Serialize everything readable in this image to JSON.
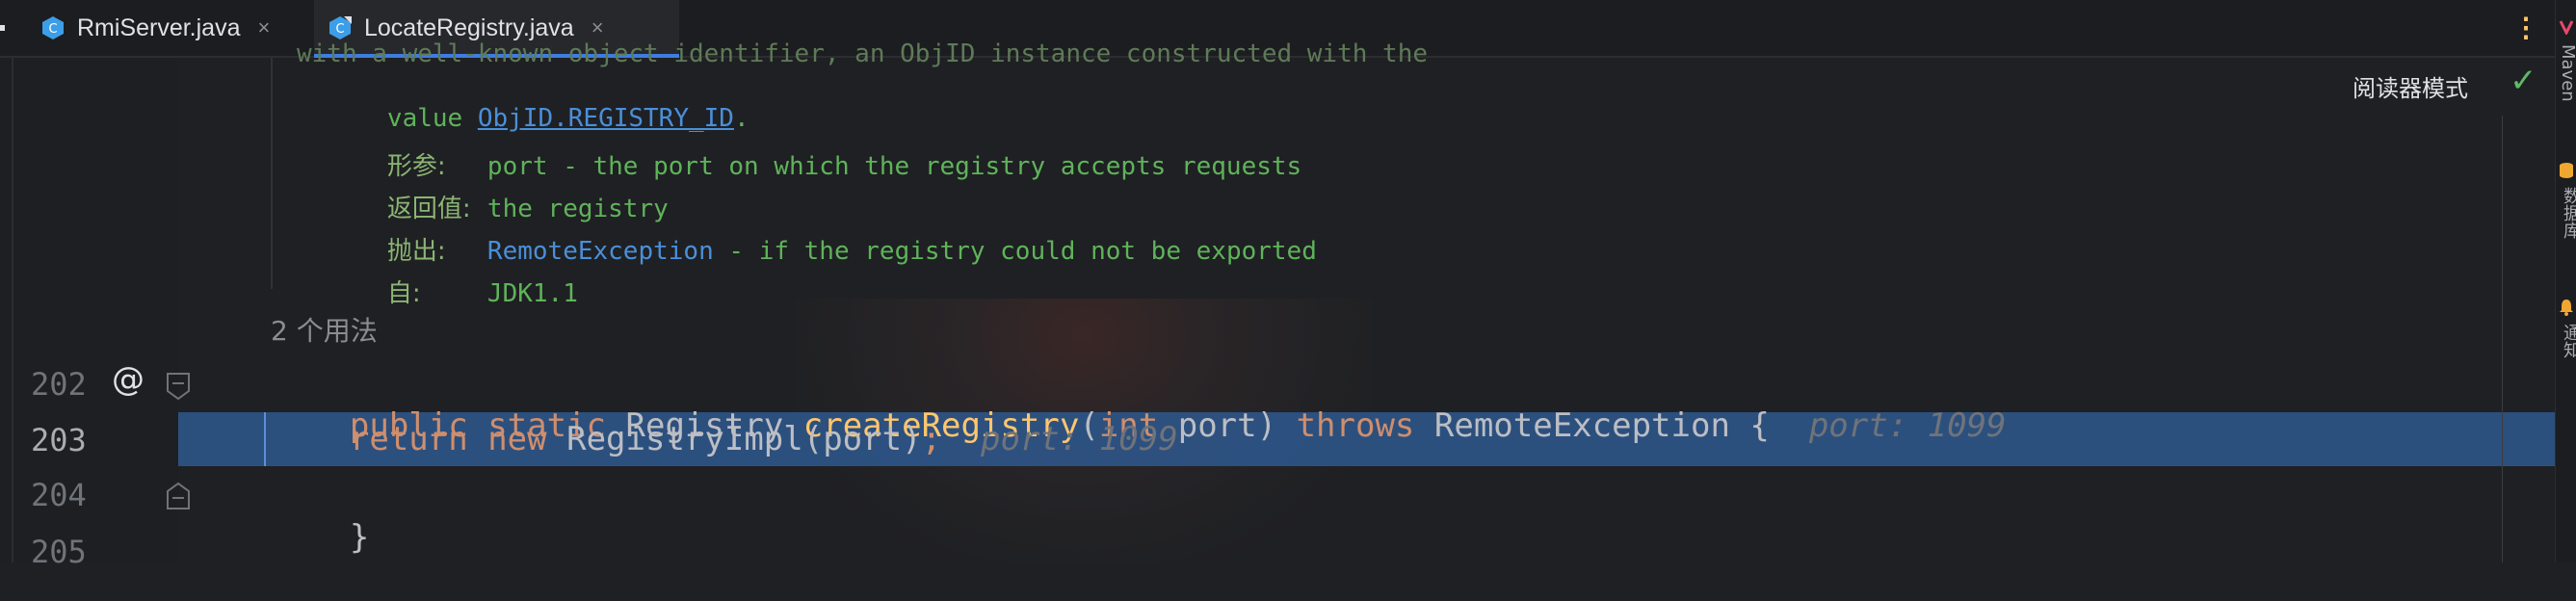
{
  "tabs": [
    {
      "label": "RmiServer.java",
      "close": "×",
      "active": false
    },
    {
      "label": "LocateRegistry.java",
      "close": "×",
      "active": true
    }
  ],
  "toolbar": {
    "more_glyph": "⋮",
    "reader_mode": "阅读器模式",
    "check_glyph": "✓"
  },
  "doc": {
    "line1": "with a well-known object identifier, an ObjID instance constructed with the",
    "value_prefix": "value ",
    "value_link": "ObjID.REGISTRY_ID",
    "value_suffix": ".",
    "params_label": "形参:",
    "params_text": "port - the port on which the registry accepts requests",
    "returns_label": "返回值:",
    "returns_text": "the registry",
    "throws_label": "抛出:",
    "throws_link": "RemoteException",
    "throws_text": " - if the registry could not be exported",
    "since_label": "自:",
    "since_text": "JDK1.1",
    "usages": "2 个用法"
  },
  "code": {
    "line202": {
      "number": "202",
      "kw1": "public",
      "kw2": "static",
      "type": "Registry",
      "fn": "createRegistry",
      "paren_open": "(",
      "ptype": "int",
      "pname": "port) ",
      "throws": "throws",
      "exc": "RemoteException {",
      "hint": "port: 1099"
    },
    "line203": {
      "number": "203",
      "kw1": "return",
      "kw2": "new",
      "call": "RegistryImpl(port)",
      "semi": ";",
      "hint": "port: 1099"
    },
    "line204": {
      "number": "204",
      "brace": "}"
    },
    "line205": {
      "number": "205"
    },
    "annotation_glyph": "@"
  },
  "side_strip": {
    "maven": "Maven",
    "database": "数据库",
    "notifications": "通知"
  },
  "colors": {
    "selection": "#2d5384",
    "accent": "#3d7de0",
    "keyword": "#cf8e6d",
    "function": "#ffc66d",
    "doc": "#5fb35a"
  }
}
